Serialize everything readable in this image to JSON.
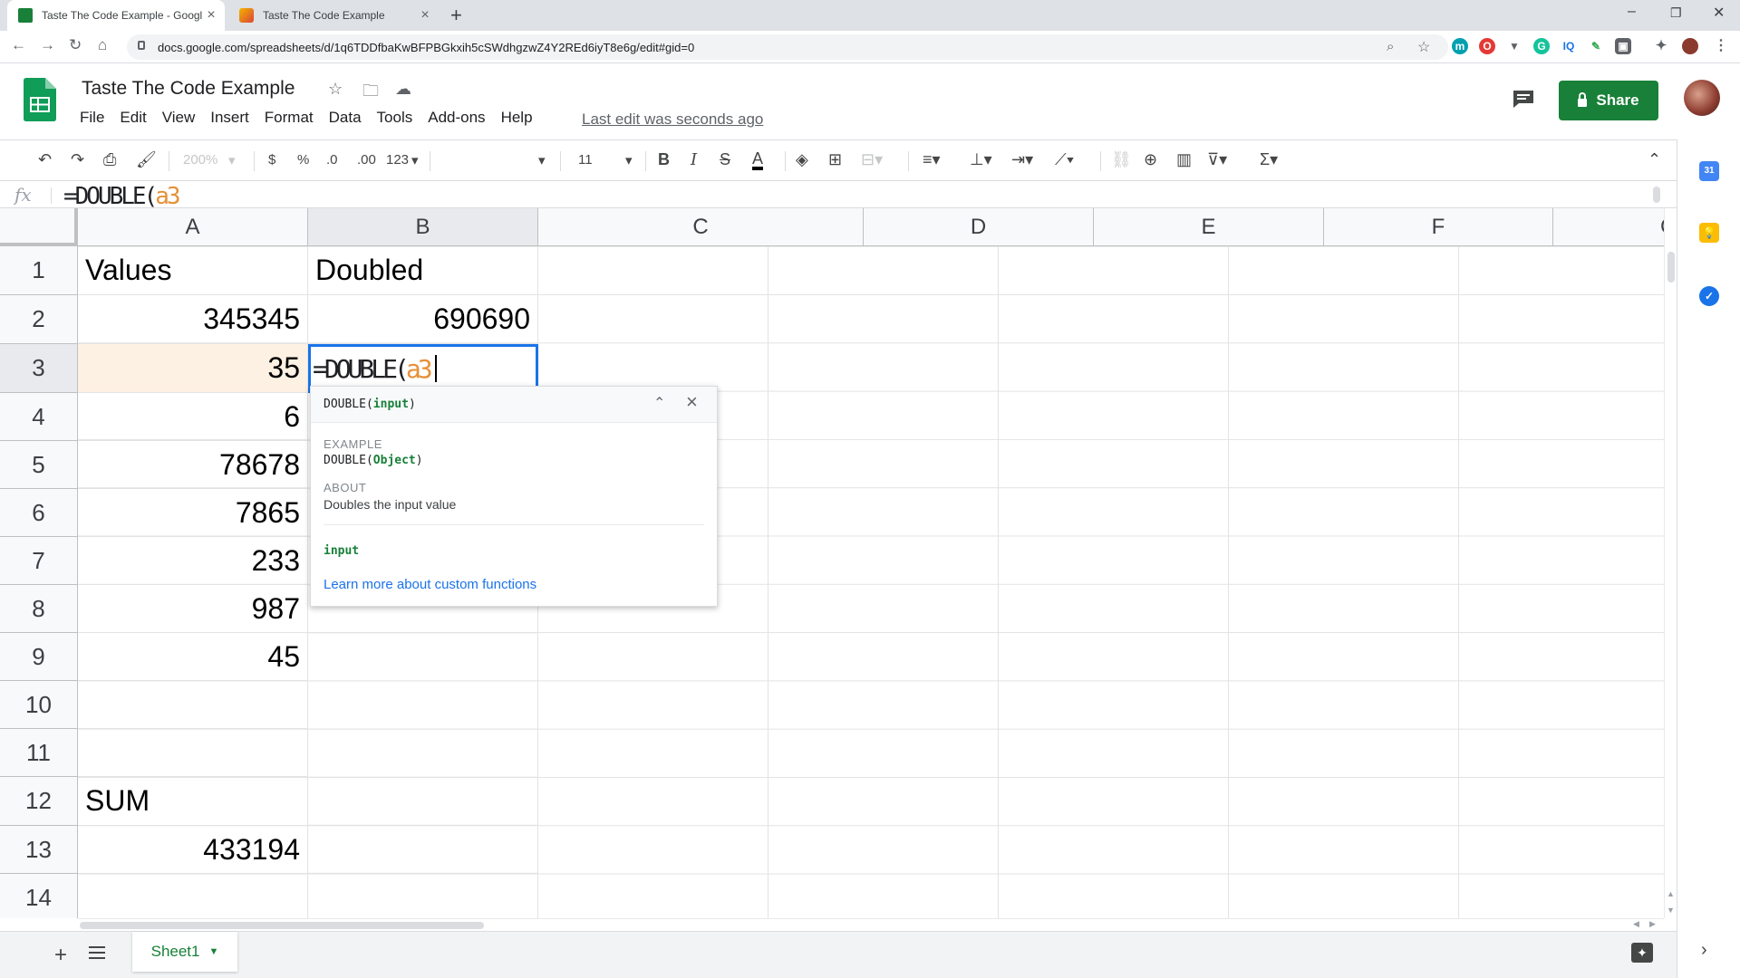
{
  "browser": {
    "tabs": [
      {
        "title": "Taste The Code Example - Googl",
        "active": true
      },
      {
        "title": "Taste The Code Example",
        "active": false
      }
    ],
    "url": "docs.google.com/spreadsheets/d/1q6TDDfbaKwBFPBGkxih5cSWdhgzwZ4Y2REd6iyT8e6g/edit#gid=0"
  },
  "doc": {
    "title": "Taste The Code Example",
    "menu": [
      "File",
      "Edit",
      "View",
      "Insert",
      "Format",
      "Data",
      "Tools",
      "Add-ons",
      "Help"
    ],
    "last_edit": "Last edit was seconds ago",
    "share_label": "Share"
  },
  "toolbar": {
    "zoom": "200%",
    "currency": "$",
    "percent": "%",
    "decrease_decimals": ".0",
    "increase_decimals": ".00",
    "more_formats": "123",
    "font_size": "11"
  },
  "formula_bar": {
    "fx": "fx",
    "formula_prefix": "=DOUBLE(",
    "formula_ref": "a3"
  },
  "grid": {
    "columns": [
      "A",
      "B",
      "C",
      "D",
      "E",
      "F",
      "G"
    ],
    "rows": [
      "1",
      "2",
      "3",
      "4",
      "5",
      "6",
      "7",
      "8",
      "9",
      "10",
      "11",
      "12",
      "13",
      "14"
    ],
    "cells": {
      "A1": "Values",
      "B1": "Doubled",
      "A2": "345345",
      "B2": "690690",
      "A3": "35",
      "A4": "6",
      "A5": "78678",
      "A6": "7865",
      "A7": "233",
      "A8": "987",
      "A9": "45",
      "A12": "SUM",
      "A13": "433194"
    },
    "active_cell": {
      "ref": "B3",
      "text_prefix": "=DOUBLE(",
      "text_ref": "a3"
    }
  },
  "help_popup": {
    "fn_name": "DOUBLE",
    "signature_arg": "input",
    "example_label": "EXAMPLE",
    "example_arg": "Object",
    "about_label": "ABOUT",
    "about_text": "Doubles the input value",
    "arg_name": "input",
    "learn_more": "Learn more about custom functions"
  },
  "sheets": {
    "tab_name": "Sheet1"
  },
  "side_panel": {
    "calendar_day": "31"
  },
  "colors": {
    "accent_green": "#188038",
    "selection_blue": "#1a73e8",
    "ref_orange": "#e69138",
    "highlight_cell": "#fdf1e3"
  },
  "icons": [
    "back-icon",
    "forward-icon",
    "reload-icon",
    "home-icon",
    "lock-icon",
    "zoom-icon",
    "star-icon",
    "extensions-icon",
    "menu-dots-icon",
    "sheets-logo-icon",
    "move-to-folder-icon",
    "cloud-status-icon",
    "comment-icon",
    "undo-icon",
    "redo-icon",
    "print-icon",
    "paint-format-icon",
    "bold-icon",
    "italic-icon",
    "strikethrough-icon",
    "text-color-icon",
    "fill-color-icon",
    "borders-icon",
    "merge-icon",
    "align-icon",
    "valign-icon",
    "wrap-icon",
    "rotate-icon",
    "link-icon",
    "comment-add-icon",
    "chart-icon",
    "filter-icon",
    "functions-icon",
    "collapse-icon",
    "calendar-icon",
    "keep-icon",
    "tasks-icon",
    "explore-icon",
    "expand-panel-icon"
  ]
}
